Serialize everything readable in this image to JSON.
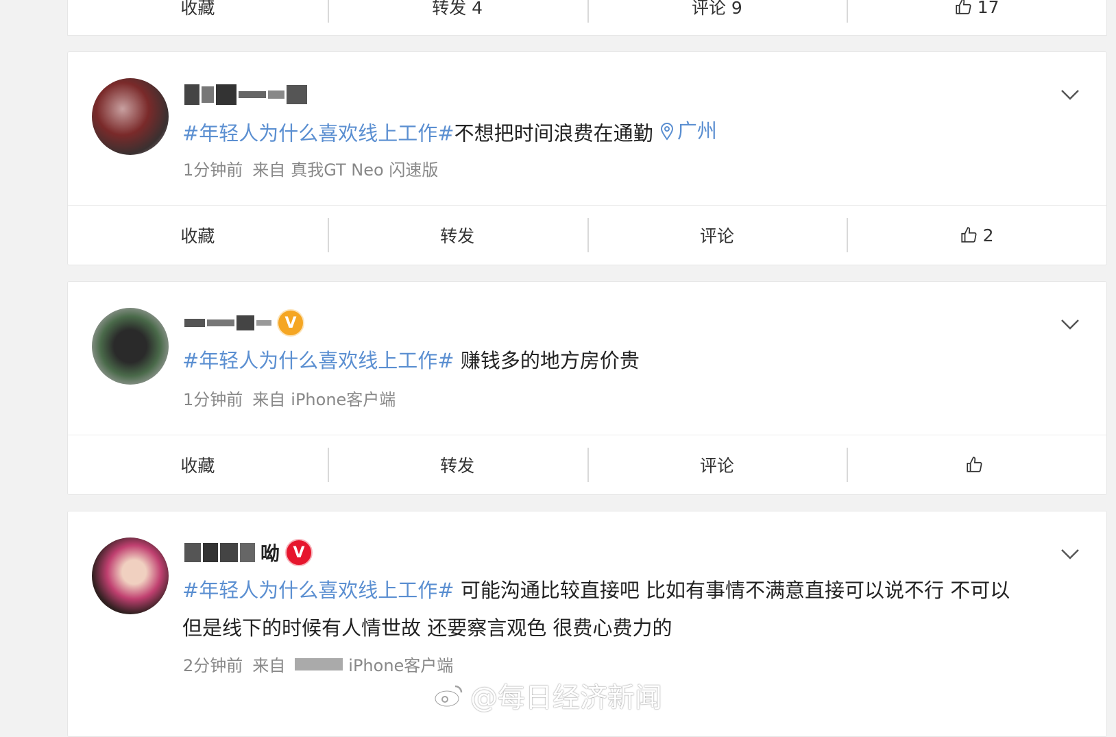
{
  "top_actions": {
    "fav": "收藏",
    "repost": "转发 4",
    "comment": "评论 9",
    "like": "17"
  },
  "posts": [
    {
      "hashtag": "#年轻人为什么喜欢线上工作#",
      "text": "不想把时间浪费在通勤",
      "location": "广州",
      "time": "1分钟前",
      "from_label": "来自",
      "source": "真我GT Neo 闪速版",
      "actions": {
        "fav": "收藏",
        "repost": "转发",
        "comment": "评论",
        "like": "2"
      }
    },
    {
      "hashtag": "#年轻人为什么喜欢线上工作#",
      "text": " 赚钱多的地方房价贵",
      "time": "1分钟前",
      "from_label": "来自",
      "source": "iPhone客户端",
      "badge": "V",
      "actions": {
        "fav": "收藏",
        "repost": "转发",
        "comment": "评论",
        "like": ""
      }
    },
    {
      "name_suffix": "呦",
      "hashtag": "#年轻人为什么喜欢线上工作#",
      "text_line1": " 可能沟通比较直接吧 比如有事情不满意直接可以说不行 不可以",
      "text_line2": "但是线下的时候有人情世故 还要察言观色 很费心费力的",
      "time": "2分钟前",
      "from_label": "来自",
      "source": "iPhone客户端",
      "badge": "V"
    }
  ],
  "watermark": "@每日经济新闻",
  "colors": {
    "link": "#5b8fd1",
    "badge_orange": "#f5a623",
    "badge_red": "#e6162d"
  },
  "icons": [
    "thumbs-up-icon",
    "chevron-down-icon",
    "location-pin-icon",
    "verified-badge-icon",
    "weibo-logo-icon"
  ]
}
